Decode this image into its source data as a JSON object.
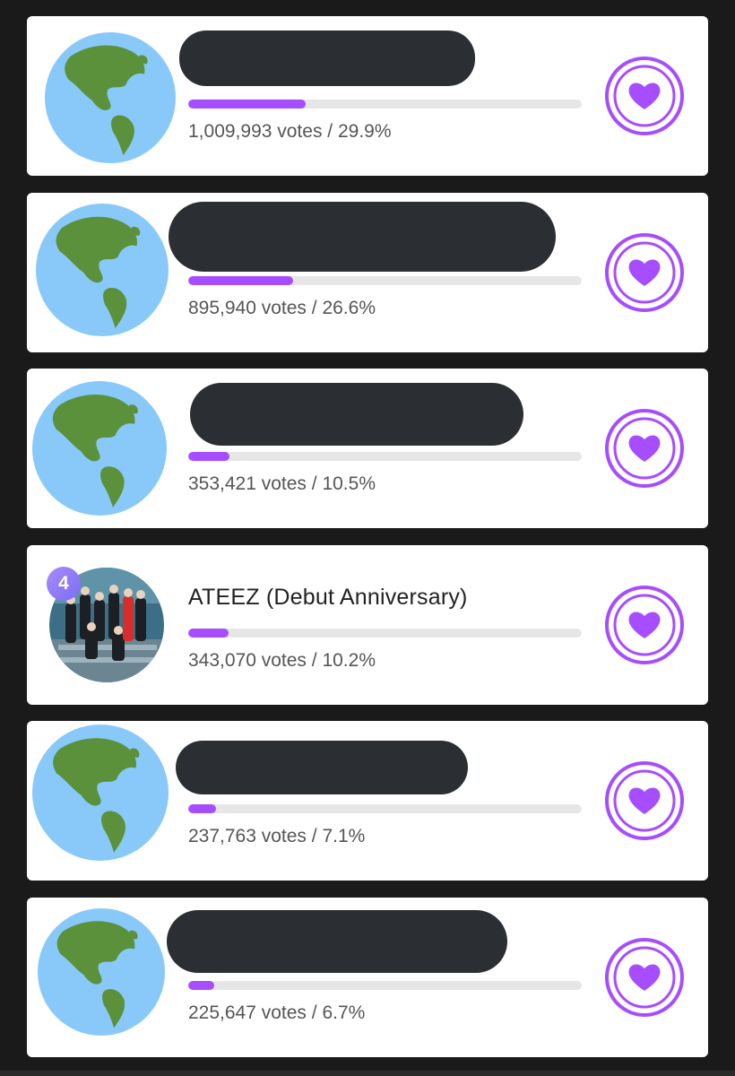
{
  "entries": [
    {
      "rank": "",
      "name": "",
      "votes_text": "1,009,993 votes / 29.9%",
      "percent": 29.9
    },
    {
      "rank": "",
      "name": "",
      "votes_text": "895,940 votes / 26.6%",
      "percent": 26.6
    },
    {
      "rank": "",
      "name": "",
      "votes_text": "353,421 votes / 10.5%",
      "percent": 10.5
    },
    {
      "rank": "4",
      "name": "ATEEZ (Debut Anniversary)",
      "votes_text": "343,070 votes / 10.2%",
      "percent": 10.2
    },
    {
      "rank": "",
      "name": "",
      "votes_text": "237,763 votes / 7.1%",
      "percent": 7.1
    },
    {
      "rank": "",
      "name": "",
      "votes_text": "225,647 votes / 6.7%",
      "percent": 6.7
    }
  ],
  "icons": {
    "avatar_placeholder": "globe-icon",
    "vote": "heart-icon"
  },
  "colors": {
    "accent": "#a64dff",
    "badge": "#8b7cf6",
    "redaction": "#2b2f33",
    "background": "#1a1a1a"
  }
}
